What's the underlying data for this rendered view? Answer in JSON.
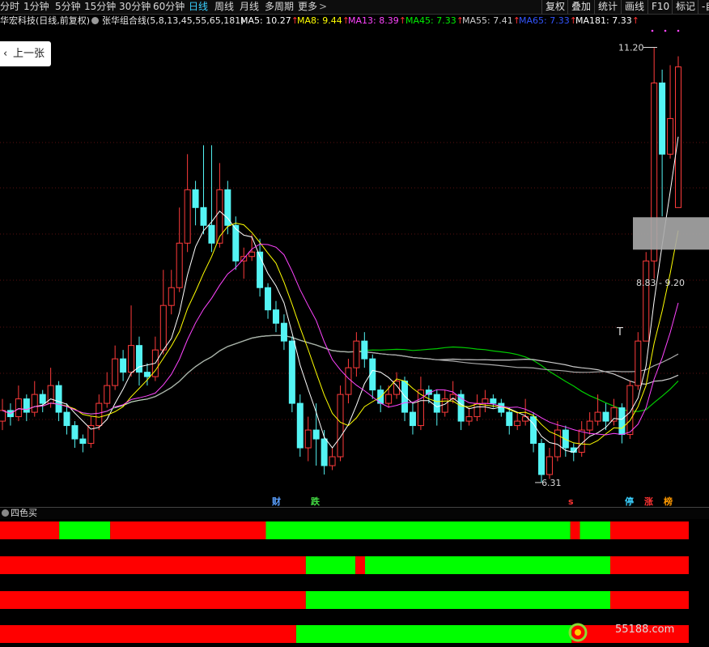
{
  "toolbar": {
    "periods": [
      "分时",
      "1分钟",
      "5分钟",
      "15分钟",
      "30分钟",
      "60分钟",
      "日线",
      "周线",
      "月线",
      "多周期",
      "更多"
    ],
    "active_period": "日线",
    "more_chevron": ">",
    "right_buttons": [
      "复权",
      "叠加",
      "统计",
      "画线",
      "F10",
      "标记",
      "-自"
    ]
  },
  "info": {
    "stock_title": "华宏科技(日线,前复权)",
    "indicator_name": "张华组合线(5,8,13,45,55,65,181)",
    "ma_items": [
      {
        "label": "MA5: 10.27",
        "color": "#ffffff"
      },
      {
        "label": "MA8: 9.44",
        "color": "#ffff00"
      },
      {
        "label": "MA13: 8.39",
        "color": "#ff44ff"
      },
      {
        "label": "MA45: 7.33",
        "color": "#00ee00"
      },
      {
        "label": "MA55: 7.41",
        "color": "#cccccc"
      },
      {
        "label": "MA65: 7.33",
        "color": "#3355ff"
      },
      {
        "label": "MA181: 7.33",
        "color": "#ffffff"
      }
    ],
    "up_arrow": "↑"
  },
  "back_button": {
    "label": "上一张",
    "icon": "chevron-left-icon"
  },
  "annotations": {
    "high": "11.20",
    "low": "6.31",
    "range": "8.83 - 9.20",
    "cursor": "T",
    "marks": [
      {
        "text": "财",
        "color": "#5aa0ff"
      },
      {
        "text": "跌",
        "color": "#44dd44"
      },
      {
        "text": "s",
        "color": "#ff3333"
      },
      {
        "text": "停",
        "color": "#3ad0ff"
      },
      {
        "text": "涨",
        "color": "#ff3333"
      },
      {
        "text": "榜",
        "color": "#ff9900"
      }
    ]
  },
  "sub_panel": {
    "title": "四色买"
  },
  "watermark": {
    "text": "55188.com"
  },
  "colors": {
    "up": "#ff3b3b",
    "down": "#54f4f4",
    "bar_red": "#ff0000",
    "bar_green": "#00ff00"
  },
  "chart_data": {
    "type": "candlestick",
    "high_label": 11.2,
    "low_label": 6.31,
    "last_ma": {
      "MA5": 10.27,
      "MA8": 9.44,
      "MA13": 8.39,
      "MA45": 7.33,
      "MA55": 7.41,
      "MA65": 7.33,
      "MA181": 7.33
    },
    "candles": [
      [
        7.0,
        7.12,
        7.25,
        6.9
      ],
      [
        7.12,
        7.05,
        7.2,
        6.95
      ],
      [
        7.05,
        7.25,
        7.4,
        7.0
      ],
      [
        7.25,
        7.1,
        7.3,
        7.0
      ],
      [
        7.1,
        7.3,
        7.45,
        7.05
      ],
      [
        7.3,
        7.2,
        7.35,
        7.1
      ],
      [
        7.2,
        7.4,
        7.6,
        7.15
      ],
      [
        7.4,
        7.1,
        7.45,
        7.0
      ],
      [
        7.1,
        6.95,
        7.2,
        6.85
      ],
      [
        6.95,
        6.8,
        7.0,
        6.7
      ],
      [
        6.8,
        6.75,
        6.85,
        6.65
      ],
      [
        6.75,
        6.95,
        7.05,
        6.7
      ],
      [
        6.95,
        7.2,
        7.3,
        6.9
      ],
      [
        7.2,
        7.4,
        7.55,
        7.15
      ],
      [
        7.4,
        7.7,
        7.85,
        7.35
      ],
      [
        7.7,
        7.55,
        7.8,
        7.45
      ],
      [
        7.55,
        7.85,
        8.3,
        7.5
      ],
      [
        7.85,
        7.55,
        7.95,
        7.4
      ],
      [
        7.55,
        7.5,
        7.65,
        7.4
      ],
      [
        7.5,
        7.8,
        7.95,
        7.45
      ],
      [
        7.8,
        8.3,
        8.7,
        7.75
      ],
      [
        8.3,
        8.5,
        8.7,
        8.2
      ],
      [
        8.5,
        9.0,
        9.4,
        8.45
      ],
      [
        9.0,
        9.6,
        10.0,
        8.9
      ],
      [
        9.6,
        9.4,
        9.7,
        9.2
      ],
      [
        9.4,
        9.2,
        10.1,
        9.1
      ],
      [
        9.2,
        9.0,
        10.1,
        8.9
      ],
      [
        9.0,
        9.6,
        9.9,
        8.95
      ],
      [
        9.6,
        9.2,
        9.7,
        9.1
      ],
      [
        9.2,
        8.8,
        9.3,
        8.7
      ],
      [
        8.8,
        8.85,
        8.95,
        8.6
      ],
      [
        8.85,
        8.9,
        9.1,
        8.8
      ],
      [
        8.9,
        8.5,
        9.05,
        8.4
      ],
      [
        8.5,
        8.25,
        8.55,
        8.15
      ],
      [
        8.25,
        8.1,
        8.35,
        8.0
      ],
      [
        8.1,
        7.9,
        8.2,
        7.8
      ],
      [
        7.9,
        7.2,
        7.95,
        7.1
      ],
      [
        7.2,
        6.7,
        7.3,
        6.6
      ],
      [
        6.7,
        6.9,
        7.05,
        6.55
      ],
      [
        6.9,
        6.8,
        7.2,
        6.5
      ],
      [
        6.8,
        6.5,
        6.9,
        6.4
      ],
      [
        6.5,
        6.6,
        6.7,
        6.45
      ],
      [
        6.6,
        7.3,
        7.4,
        6.55
      ],
      [
        7.3,
        7.6,
        7.7,
        7.2
      ],
      [
        7.6,
        7.9,
        8.0,
        7.5
      ],
      [
        7.9,
        7.7,
        8.0,
        7.6
      ],
      [
        7.7,
        7.35,
        7.75,
        7.25
      ],
      [
        7.35,
        7.2,
        7.4,
        7.1
      ],
      [
        7.2,
        7.3,
        7.4,
        7.15
      ],
      [
        7.3,
        7.45,
        7.55,
        7.25
      ],
      [
        7.45,
        7.1,
        7.5,
        7.0
      ],
      [
        7.1,
        6.95,
        7.2,
        6.85
      ],
      [
        6.95,
        7.35,
        7.5,
        6.9
      ],
      [
        7.35,
        7.3,
        7.4,
        7.2
      ],
      [
        7.3,
        7.1,
        7.35,
        6.95
      ],
      [
        7.1,
        7.25,
        7.35,
        7.05
      ],
      [
        7.25,
        7.3,
        7.45,
        7.2
      ],
      [
        7.3,
        7.0,
        7.35,
        6.9
      ],
      [
        7.0,
        7.05,
        7.15,
        6.95
      ],
      [
        7.05,
        7.2,
        7.3,
        7.0
      ],
      [
        7.2,
        7.25,
        7.35,
        7.1
      ],
      [
        7.25,
        7.2,
        7.3,
        7.15
      ],
      [
        7.2,
        7.1,
        7.25,
        7.05
      ],
      [
        7.1,
        6.95,
        7.15,
        6.85
      ],
      [
        6.95,
        7.0,
        7.1,
        6.9
      ],
      [
        7.0,
        7.05,
        7.25,
        6.95
      ],
      [
        7.05,
        6.75,
        7.1,
        6.65
      ],
      [
        6.75,
        6.4,
        6.8,
        6.31
      ],
      [
        6.4,
        6.6,
        6.7,
        6.35
      ],
      [
        6.6,
        6.9,
        7.0,
        6.55
      ],
      [
        6.9,
        6.7,
        6.95,
        6.6
      ],
      [
        6.7,
        6.65,
        6.75,
        6.55
      ],
      [
        6.65,
        6.9,
        7.0,
        6.6
      ],
      [
        6.9,
        7.0,
        7.1,
        6.85
      ],
      [
        7.0,
        7.1,
        7.3,
        6.95
      ],
      [
        7.1,
        7.0,
        7.2,
        6.9
      ],
      [
        7.0,
        7.15,
        7.25,
        6.95
      ],
      [
        7.15,
        6.85,
        7.2,
        6.75
      ],
      [
        6.85,
        7.4,
        7.45,
        6.8
      ],
      [
        7.4,
        7.9,
        8.0,
        7.35
      ],
      [
        7.9,
        8.8,
        8.9,
        7.9
      ],
      [
        8.8,
        10.8,
        11.2,
        8.6
      ],
      [
        10.8,
        10.0,
        10.95,
        9.3
      ],
      [
        10.0,
        10.4,
        11.0,
        9.95
      ],
      [
        9.4,
        10.98,
        11.1,
        9.4
      ]
    ],
    "y_range": [
      6.2,
      11.35
    ],
    "four_color_buy_bars": [
      {
        "segments": [
          {
            "end": 0.086,
            "color": "red"
          },
          {
            "end": 0.16,
            "color": "green"
          },
          {
            "end": 0.386,
            "color": "red"
          },
          {
            "end": 0.828,
            "color": "green"
          },
          {
            "end": 0.842,
            "color": "red"
          },
          {
            "end": 0.886,
            "color": "green"
          },
          {
            "end": 1.0,
            "color": "red"
          }
        ]
      },
      {
        "segments": [
          {
            "end": 0.444,
            "color": "red"
          },
          {
            "end": 0.516,
            "color": "green"
          },
          {
            "end": 0.53,
            "color": "red"
          },
          {
            "end": 0.886,
            "color": "green"
          },
          {
            "end": 1.0,
            "color": "red"
          }
        ]
      },
      {
        "segments": [
          {
            "end": 0.444,
            "color": "red"
          },
          {
            "end": 0.886,
            "color": "green"
          },
          {
            "end": 1.0,
            "color": "red"
          }
        ]
      },
      {
        "segments": [
          {
            "end": 0.43,
            "color": "red"
          },
          {
            "end": 0.83,
            "color": "green"
          },
          {
            "end": 1.0,
            "color": "red"
          }
        ]
      }
    ]
  }
}
